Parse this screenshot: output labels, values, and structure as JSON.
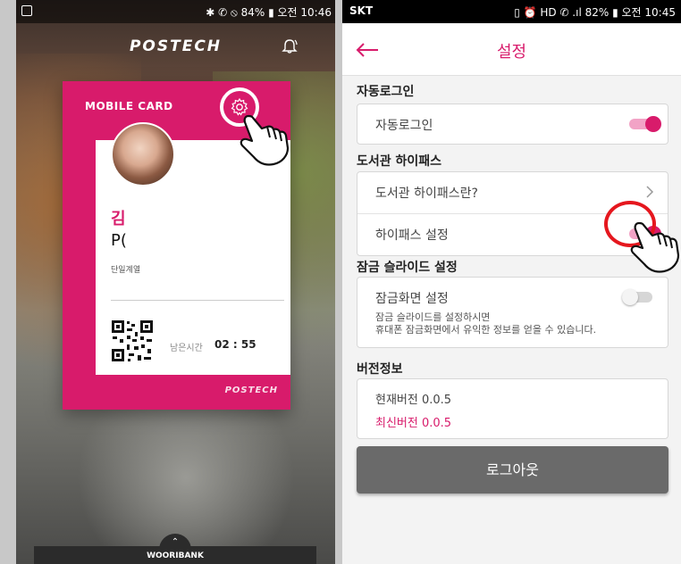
{
  "left_phone": {
    "status_bar": {
      "right_text": "✱ ✆ ⦸ 84% ▮ 오전 10:46"
    },
    "brand": "POSTECH",
    "card": {
      "title": "MOBILE CARD",
      "name": "김",
      "id": "P(",
      "department": "단일계열",
      "remaining_label": "남은시간",
      "remaining_time": "02 : 55",
      "footer_logo": "POSTECH"
    },
    "bottom_bar": {
      "label": "WOORIBANK",
      "arrow": "⌃"
    }
  },
  "right_phone": {
    "status_bar": {
      "carrier": "SKT",
      "right_text": "▯ ⏰ HD ✆ .ıl 82% ▮ 오전 10:45"
    },
    "header": {
      "title": "설정"
    },
    "sections": {
      "auto_login": {
        "label": "자동로그인",
        "rows": [
          {
            "label": "자동로그인",
            "toggle": "on"
          }
        ]
      },
      "library": {
        "label": "도서관 하이패스",
        "rows": [
          {
            "label": "도서관 하이패스란?"
          },
          {
            "label": "하이패스 설정",
            "toggle": "on"
          }
        ]
      },
      "lock_slide": {
        "label": "잠금 슬라이드 설정",
        "rows": [
          {
            "label": "잠금화면 설정",
            "toggle": "off"
          }
        ],
        "description_line1": "잠금 슬라이드를 설정하시면",
        "description_line2": "휴대폰 잠금화면에서 유익한 정보를 얻을 수 있습니다."
      },
      "version": {
        "label": "버전정보",
        "current": "현재버전 0.0.5",
        "latest": "최신버전 0.0.5"
      }
    },
    "logout_label": "로그아웃"
  },
  "colors": {
    "accent": "#d81b6b",
    "toggle_track_on": "#f2a3c6",
    "highlight_ring": "#e5171e",
    "logout_bg": "#6a6a6a"
  },
  "icons": [
    "bell-icon",
    "gear-icon",
    "back-arrow-icon",
    "chevron-right-icon",
    "pointing-hand-icon",
    "qr-code"
  ]
}
